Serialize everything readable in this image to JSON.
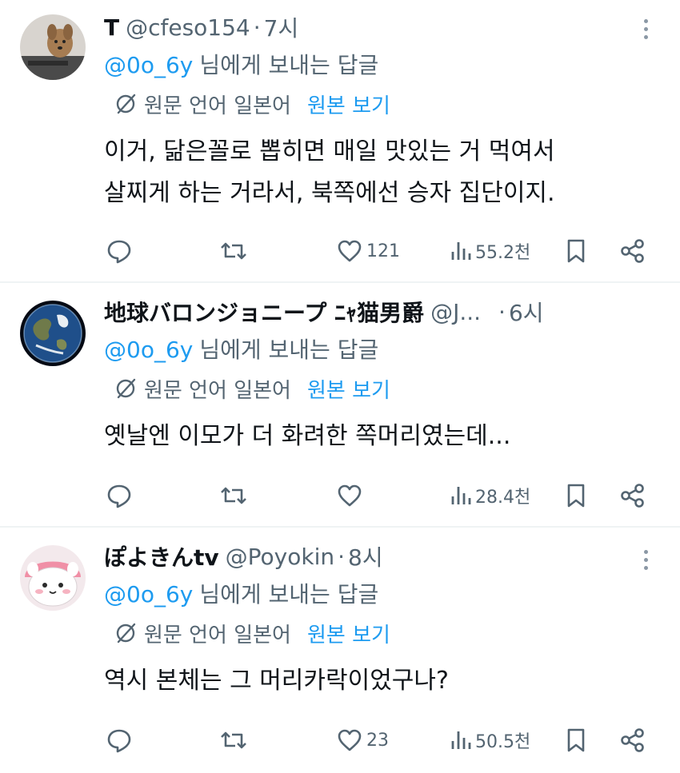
{
  "tweets": [
    {
      "name": "T",
      "handle": "@cfeso154",
      "separator": "·",
      "time": "7시",
      "reply_mention": "@0o_6y",
      "reply_text": "님에게 보내는 답글",
      "translate_lang": "원문 언어 일본어",
      "translate_link": "원본 보기",
      "body_lines": [
        "이거, 닮은꼴로 뽑히면 매일 맛있는 거 먹여서",
        "살찌게 하는 거라서, 북쪽에선 승자 집단이지."
      ],
      "likes": "121",
      "views": "55.2천",
      "avatar": "dog-photo"
    },
    {
      "name": "地球バロンジョニープ ﾆｬ猫男爵",
      "handle": "@J...",
      "separator": "·",
      "time": "6시",
      "reply_mention": "@0o_6y",
      "reply_text": "님에게 보내는 답글",
      "translate_lang": "원문 언어 일본어",
      "translate_link": "원본 보기",
      "body_lines": [
        "옛날엔 이모가 더 화려한 쪽머리였는데..."
      ],
      "likes": "",
      "views": "28.4천",
      "avatar": "earth-globe"
    },
    {
      "name": "ぽよきんtv",
      "handle": "@Poyokin",
      "separator": "·",
      "time": "8시",
      "reply_mention": "@0o_6y",
      "reply_text": "님에게 보내는 답글",
      "translate_lang": "원문 언어 일본어",
      "translate_link": "원본 보기",
      "body_lines": [
        "역시 본체는 그 머리카락이었구나?"
      ],
      "likes": "23",
      "views": "50.5천",
      "avatar": "cartoon-character"
    }
  ],
  "icons": {
    "more": "more-vertical-icon",
    "translate": "translate-slash-icon",
    "reply": "comment-bubble-icon",
    "retweet": "retweet-icon",
    "like": "heart-icon",
    "views": "bar-chart-icon",
    "bookmark": "bookmark-icon",
    "share": "share-icon"
  },
  "colors": {
    "link": "#1d9bf0",
    "secondary": "#536471",
    "text": "#0f1419",
    "divider": "#eff3f4"
  }
}
